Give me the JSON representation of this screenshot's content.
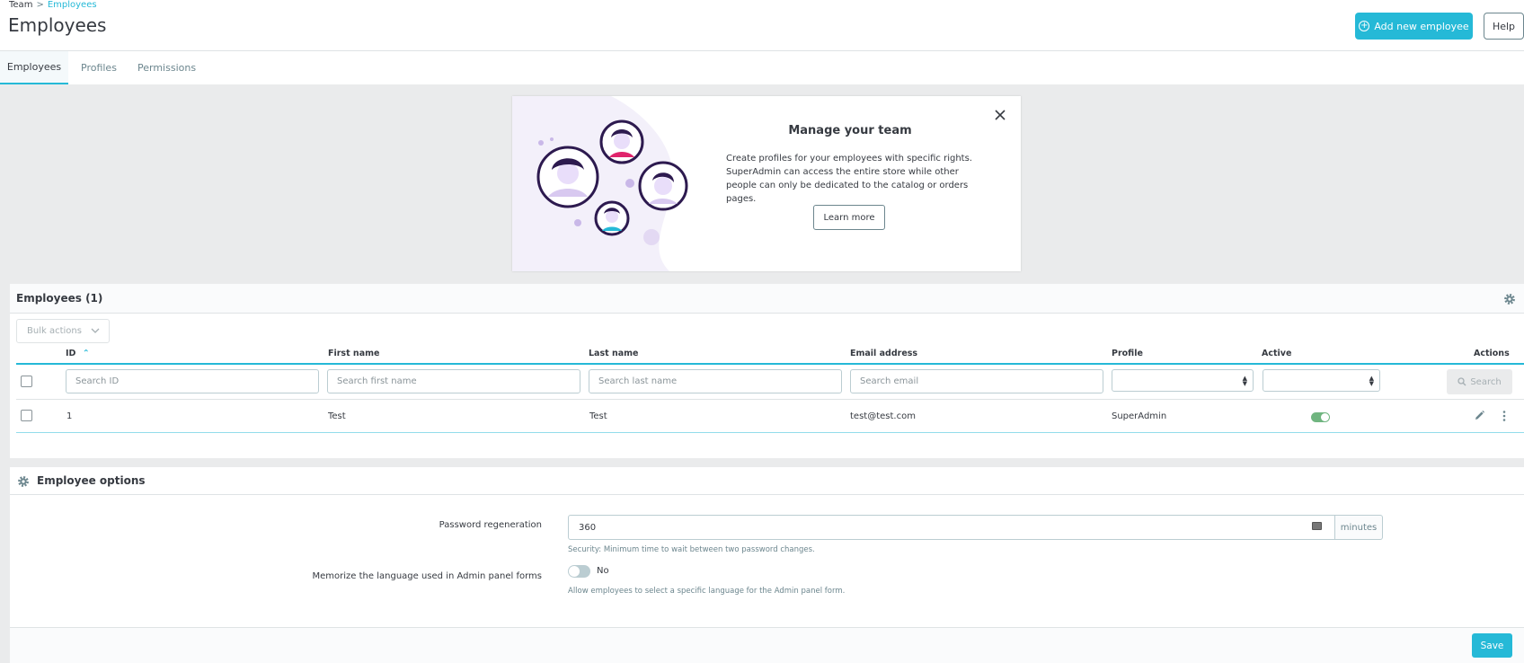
{
  "breadcrumb": {
    "parent": "Team",
    "separator": ">",
    "current": "Employees"
  },
  "page": {
    "title": "Employees"
  },
  "toolbar": {
    "add_label": "Add new employee",
    "help_label": "Help"
  },
  "tabs": [
    {
      "label": "Employees",
      "active": true
    },
    {
      "label": "Profiles",
      "active": false
    },
    {
      "label": "Permissions",
      "active": false
    }
  ],
  "promo": {
    "title": "Manage your team",
    "text": "Create profiles for your employees with specific rights. SuperAdmin can access the entire store while other people can only be dedicated to the catalog or orders pages.",
    "button": "Learn more"
  },
  "employees_card": {
    "title": "Employees (1)",
    "bulk_actions": "Bulk actions",
    "columns": [
      "ID",
      "First name",
      "Last name",
      "Email address",
      "Profile",
      "Active",
      "Actions"
    ],
    "filters": {
      "id_placeholder": "Search ID",
      "first_name_placeholder": "Search first name",
      "last_name_placeholder": "Search last name",
      "email_placeholder": "Search email",
      "search_button": "Search"
    },
    "rows": [
      {
        "id": "1",
        "first_name": "Test",
        "last_name": "Test",
        "email": "test@test.com",
        "profile": "SuperAdmin",
        "active": true
      }
    ]
  },
  "options_card": {
    "title": "Employee options",
    "password_label": "Password regeneration",
    "password_value": "360",
    "password_unit": "minutes",
    "password_help": "Security: Minimum time to wait between two password changes.",
    "memorize_label": "Memorize the language used in Admin panel forms",
    "memorize_value": "No",
    "memorize_help": "Allow employees to select a specific language for the Admin panel form.",
    "save_label": "Save"
  },
  "colors": {
    "accent": "#25b9d7",
    "active_toggle": "#70b580",
    "text": "#363a41",
    "muted": "#6c868e"
  }
}
